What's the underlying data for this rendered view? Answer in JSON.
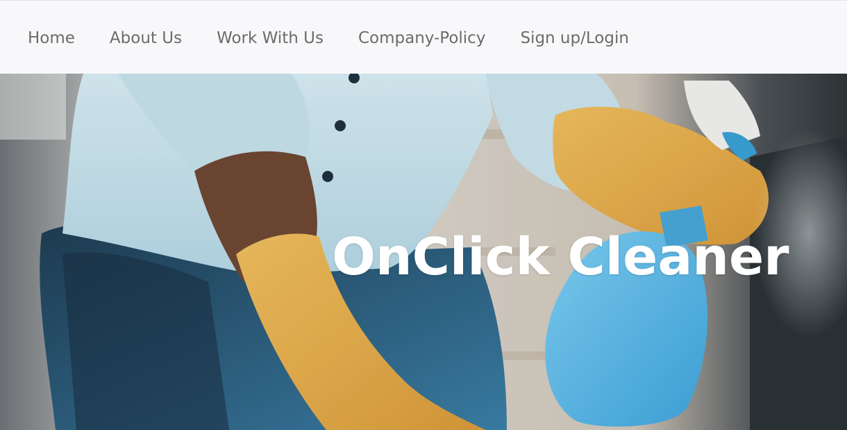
{
  "nav": {
    "items": [
      {
        "label": "Home"
      },
      {
        "label": "About Us"
      },
      {
        "label": "Work With Us"
      },
      {
        "label": "Company-Policy"
      },
      {
        "label": "Sign up/Login"
      }
    ]
  },
  "hero": {
    "title": "OnClick Cleaner",
    "image_description_icon": "cleaner-spray-photo"
  },
  "colors": {
    "nav_background": "#f8f8fa",
    "nav_text": "#6b6b6b",
    "hero_title": "#ffffff",
    "glove": "#e6a84a",
    "bottle": "#5ab4e8"
  }
}
